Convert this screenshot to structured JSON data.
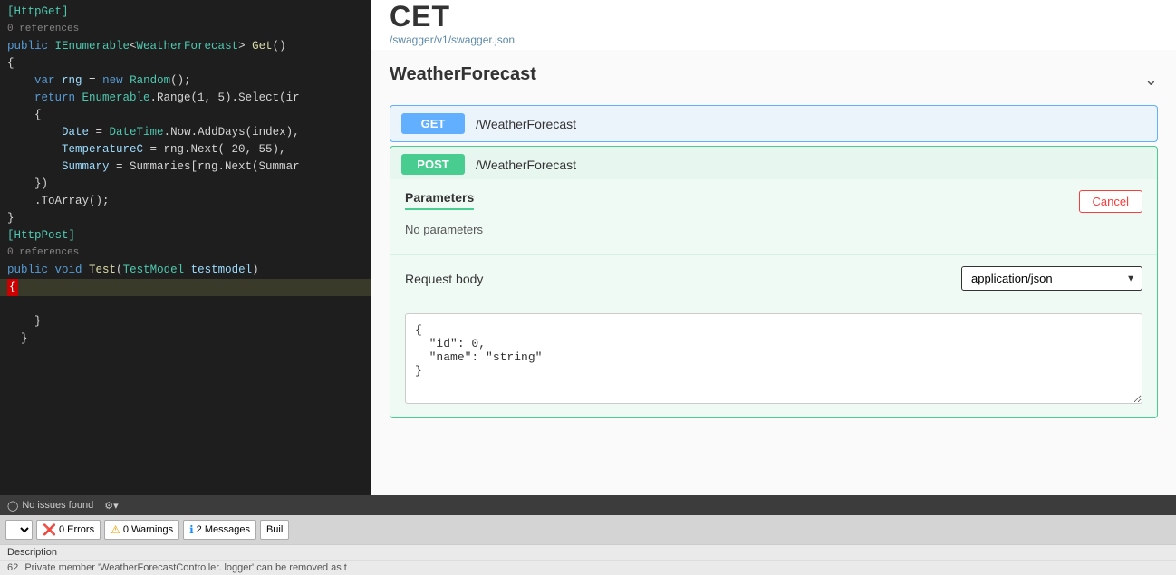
{
  "editor": {
    "lines": [
      {
        "num": "",
        "tokens": [
          {
            "text": "[HttpGet]",
            "cls": "annotation"
          }
        ]
      },
      {
        "num": "",
        "tokens": [
          {
            "text": "0 references",
            "cls": "ref-text"
          }
        ]
      },
      {
        "num": "",
        "tokens": [
          {
            "text": "public ",
            "cls": "kw"
          },
          {
            "text": "IEnumerable",
            "cls": "type"
          },
          {
            "text": "<",
            "cls": "plain"
          },
          {
            "text": "WeatherForecast",
            "cls": "type"
          },
          {
            "text": "> ",
            "cls": "plain"
          },
          {
            "text": "Get",
            "cls": "method"
          },
          {
            "text": "()",
            "cls": "plain"
          }
        ]
      },
      {
        "num": "",
        "tokens": [
          {
            "text": "{",
            "cls": "plain"
          }
        ]
      },
      {
        "num": "",
        "tokens": [
          {
            "text": "    ",
            "cls": "plain"
          },
          {
            "text": "var ",
            "cls": "kw"
          },
          {
            "text": "rng",
            "cls": "attr"
          },
          {
            "text": " = ",
            "cls": "plain"
          },
          {
            "text": "new ",
            "cls": "kw"
          },
          {
            "text": "Random",
            "cls": "type"
          },
          {
            "text": "();",
            "cls": "plain"
          }
        ]
      },
      {
        "num": "",
        "tokens": [
          {
            "text": "    ",
            "cls": "plain"
          },
          {
            "text": "return ",
            "cls": "kw"
          },
          {
            "text": "Enumerable",
            "cls": "type"
          },
          {
            "text": ".Range(1, 5).Select(ir",
            "cls": "plain"
          }
        ]
      },
      {
        "num": "",
        "tokens": [
          {
            "text": "    {",
            "cls": "plain"
          }
        ]
      },
      {
        "num": "",
        "tokens": [
          {
            "text": "        ",
            "cls": "plain"
          },
          {
            "text": "Date",
            "cls": "attr"
          },
          {
            "text": " = ",
            "cls": "plain"
          },
          {
            "text": "DateTime",
            "cls": "type"
          },
          {
            "text": ".Now.AddDays(index),",
            "cls": "plain"
          }
        ]
      },
      {
        "num": "",
        "tokens": [
          {
            "text": "        ",
            "cls": "plain"
          },
          {
            "text": "TemperatureC",
            "cls": "attr"
          },
          {
            "text": " = rng.Next(-20, 55),",
            "cls": "plain"
          }
        ]
      },
      {
        "num": "",
        "tokens": [
          {
            "text": "        ",
            "cls": "plain"
          },
          {
            "text": "Summary",
            "cls": "attr"
          },
          {
            "text": " = Summaries[rng.Next(Summar",
            "cls": "plain"
          }
        ]
      },
      {
        "num": "",
        "tokens": [
          {
            "text": "    })",
            "cls": "plain"
          }
        ]
      },
      {
        "num": "",
        "tokens": [
          {
            "text": "    ",
            "cls": "plain"
          },
          {
            "text": ".ToArray();",
            "cls": "plain"
          }
        ]
      },
      {
        "num": "",
        "tokens": [
          {
            "text": "}",
            "cls": "plain"
          }
        ]
      },
      {
        "num": "",
        "tokens": [
          {
            "text": "[HttpPost]",
            "cls": "annotation"
          }
        ]
      },
      {
        "num": "",
        "tokens": [
          {
            "text": "0 references",
            "cls": "ref-text"
          }
        ]
      },
      {
        "num": "",
        "tokens": [
          {
            "text": "public ",
            "cls": "kw"
          },
          {
            "text": "void ",
            "cls": "kw"
          },
          {
            "text": "Test",
            "cls": "method"
          },
          {
            "text": "(",
            "cls": "plain"
          },
          {
            "text": "TestModel ",
            "cls": "type"
          },
          {
            "text": "testmodel",
            "cls": "param-name"
          },
          {
            "text": ")",
            "cls": "plain"
          }
        ]
      },
      {
        "num": "",
        "tokens": [
          {
            "text": "{",
            "cls": "plain",
            "highlight": true
          }
        ]
      },
      {
        "num": "",
        "tokens": []
      },
      {
        "num": "",
        "tokens": [
          {
            "text": "}",
            "cls": "plain"
          }
        ]
      },
      {
        "num": "",
        "tokens": [
          {
            "text": "  }",
            "cls": "plain"
          }
        ]
      }
    ]
  },
  "swagger": {
    "link": "/swagger/v1/swagger.json",
    "cet_label": "CET",
    "section_title": "WeatherForecast",
    "get_endpoint": {
      "method": "GET",
      "path": "/WeatherForecast"
    },
    "post_endpoint": {
      "method": "POST",
      "path": "/WeatherForecast",
      "expanded": true,
      "params_tab": "Parameters",
      "cancel_btn": "Cancel",
      "no_params": "No parameters",
      "request_body_label": "Request body",
      "content_type": "application/json",
      "content_type_options": [
        "application/json"
      ],
      "json_body": "{\n  \"id\": 0,\n  \"name\": \"string\"\n}"
    }
  },
  "status_bar": {
    "no_issues": "No issues found",
    "gear_icon": "⚙"
  },
  "build_bar": {
    "dropdown_label": "",
    "errors_label": "0 Errors",
    "warnings_label": "0 Warnings",
    "messages_label": "2 Messages",
    "build_label": "Buil"
  },
  "description_bar": {
    "label": "Description",
    "line_num": "62",
    "text": "Private member 'WeatherForecastController. logger' can be removed as t"
  }
}
